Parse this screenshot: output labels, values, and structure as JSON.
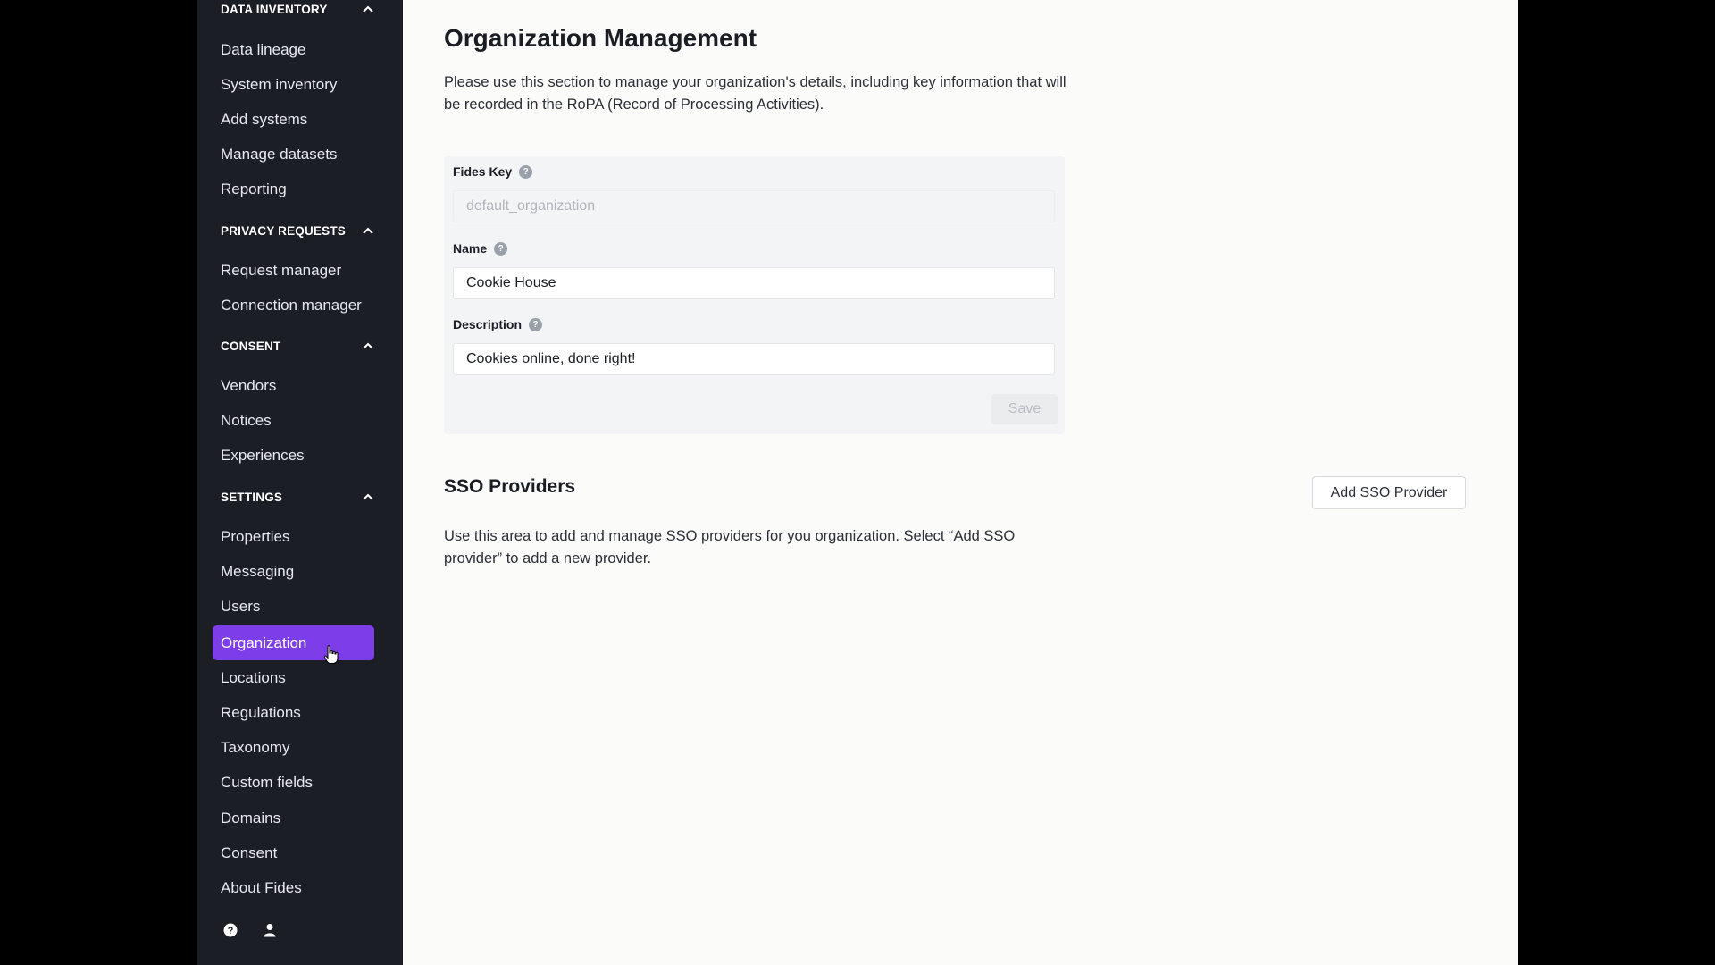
{
  "sidebar": {
    "groups": [
      {
        "header": "DATA INVENTORY",
        "items": [
          "Data lineage",
          "System inventory",
          "Add systems",
          "Manage datasets",
          "Reporting"
        ]
      },
      {
        "header": "PRIVACY REQUESTS",
        "items": [
          "Request manager",
          "Connection manager"
        ]
      },
      {
        "header": "CONSENT",
        "items": [
          "Vendors",
          "Notices",
          "Experiences"
        ]
      },
      {
        "header": "SETTINGS",
        "items": [
          "Properties",
          "Messaging",
          "Users",
          "Organization",
          "Locations",
          "Regulations",
          "Taxonomy",
          "Custom fields",
          "Domains",
          "Consent",
          "About Fides"
        ]
      }
    ],
    "active_item": "Organization",
    "accent_color": "#7d3de8"
  },
  "main": {
    "title": "Organization Management",
    "description": "Please use this section to manage your organization's details, including key information that will be recorded in the RoPA (Record of Processing Activities).",
    "form": {
      "fides_key_label": "Fides Key",
      "fides_key_value": "default_organization",
      "name_label": "Name",
      "name_value": "Cookie House",
      "description_label": "Description",
      "description_value": "Cookies online, done right!",
      "save_label": "Save",
      "help_glyph": "?"
    },
    "sso": {
      "title": "SSO Providers",
      "add_button": "Add SSO Provider",
      "description": "Use this area to add and manage SSO providers for you organization. Select “Add SSO provider” to add a new provider."
    }
  }
}
